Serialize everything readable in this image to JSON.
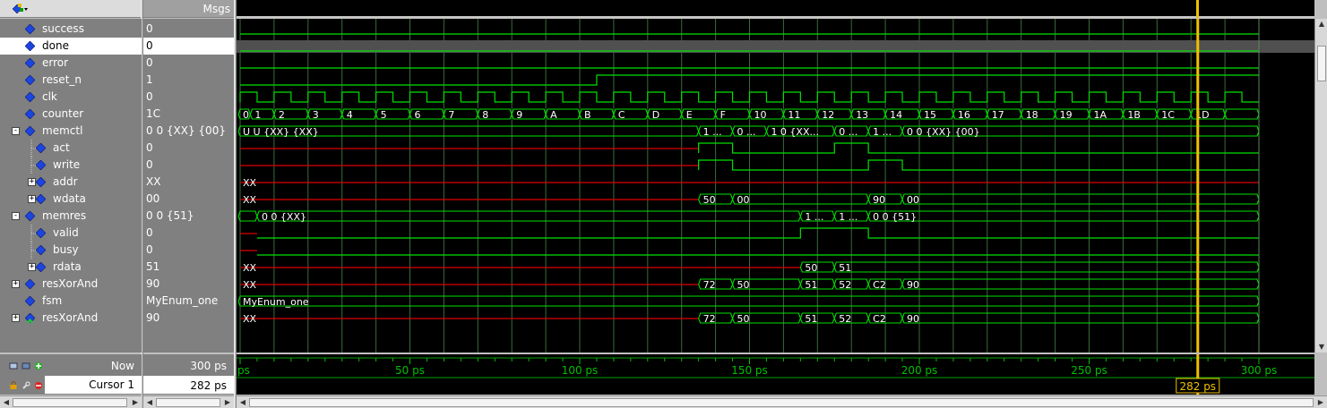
{
  "header": {
    "msgs_label": "Msgs"
  },
  "signals": [
    {
      "name": "success",
      "value": "0",
      "indent": 0,
      "expander": "",
      "sub": false
    },
    {
      "name": "done",
      "value": "0",
      "indent": 0,
      "expander": "",
      "sub": false,
      "selected": true
    },
    {
      "name": "error",
      "value": "0",
      "indent": 0,
      "expander": "",
      "sub": false
    },
    {
      "name": "reset_n",
      "value": "1",
      "indent": 0,
      "expander": "",
      "sub": false
    },
    {
      "name": "clk",
      "value": "0",
      "indent": 0,
      "expander": "",
      "sub": false
    },
    {
      "name": "counter",
      "value": "1C",
      "indent": 0,
      "expander": "",
      "sub": false
    },
    {
      "name": "memctl",
      "value": "0 0 {XX} {00}",
      "indent": 0,
      "expander": "-",
      "sub": false
    },
    {
      "name": "act",
      "value": "0",
      "indent": 1,
      "expander": "",
      "sub": true
    },
    {
      "name": "write",
      "value": "0",
      "indent": 1,
      "expander": "",
      "sub": true
    },
    {
      "name": "addr",
      "value": "XX",
      "indent": 1,
      "expander": "+",
      "sub": true
    },
    {
      "name": "wdata",
      "value": "00",
      "indent": 1,
      "expander": "+",
      "sub": true
    },
    {
      "name": "memres",
      "value": "0 0 {51}",
      "indent": 0,
      "expander": "-",
      "sub": false
    },
    {
      "name": "valid",
      "value": "0",
      "indent": 1,
      "expander": "",
      "sub": true
    },
    {
      "name": "busy",
      "value": "0",
      "indent": 1,
      "expander": "",
      "sub": true
    },
    {
      "name": "rdata",
      "value": "51",
      "indent": 1,
      "expander": "+",
      "sub": true
    },
    {
      "name": "resXorAnd",
      "value": "90",
      "indent": 0,
      "expander": "+",
      "sub": false
    },
    {
      "name": "fsm",
      "value": "MyEnum_one",
      "indent": 0,
      "expander": "",
      "sub": false
    },
    {
      "name": "resXorAnd",
      "value": "90",
      "indent": 0,
      "expander": "+",
      "sub": false,
      "alt_icon": true
    }
  ],
  "waveform": {
    "counter_labels": [
      "0",
      "1",
      "2",
      "3",
      "4",
      "5",
      "6",
      "7",
      "8",
      "9",
      "A",
      "B",
      "C",
      "D",
      "E",
      "F",
      "10",
      "11",
      "12",
      "13",
      "14",
      "15",
      "16",
      "17",
      "18",
      "19",
      "1A",
      "1B",
      "1C",
      "1D"
    ],
    "memctl_labels": [
      "U U {XX} {XX}",
      "1 ...",
      "0 ...",
      "1 0 {XX...",
      "0 ...",
      "1 ...",
      "0 0 {XX} {00}"
    ],
    "addr_label": "XX",
    "wdata_labels": [
      "XX",
      "50",
      "00",
      "90",
      "00"
    ],
    "memres_labels": [
      "0 0 {XX}",
      "1 ...",
      "1 ...",
      "0 0 {51}"
    ],
    "rdata_labels": [
      "XX",
      "50",
      "51"
    ],
    "resxorand_labels": [
      "XX",
      "72",
      "50",
      "51",
      "52",
      "C2",
      "90"
    ],
    "fsm_label": "MyEnum_one",
    "resxorand2_labels": [
      "XX",
      "72",
      "50",
      "51",
      "52",
      "C2",
      "90"
    ]
  },
  "timeline": {
    "tick_labels": [
      "ps",
      "50 ps",
      "100 ps",
      "150 ps",
      "200 ps",
      "250 ps",
      "300 ps"
    ],
    "cursor_readout": "282 ps"
  },
  "bottom": {
    "now_label": "Now",
    "now_value": "300 ps",
    "cursor_label": "Cursor 1",
    "cursor_value": "282 ps"
  },
  "colors": {
    "wave_green": "#00e000",
    "wave_red": "#e00000",
    "grid": "#3a6b3a",
    "cursor": "#f0c000",
    "ruler_text": "#00c000",
    "diamond_blue": "#1c44e0"
  },
  "icons": [
    "wave-logo-icon",
    "signal-diamond-icon",
    "expand-icon",
    "collapse-icon",
    "lock-icon",
    "wrench-icon",
    "remove-icon",
    "zoom-icon",
    "add-icon"
  ]
}
